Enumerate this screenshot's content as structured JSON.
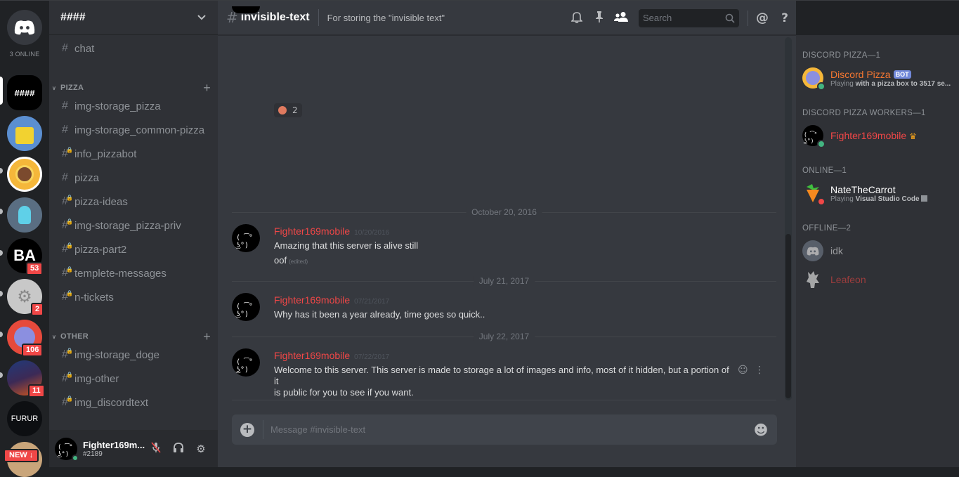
{
  "guilds": {
    "online_count": "3 ONLINE",
    "selected_guild_label": "####",
    "badges": [
      "53",
      "2",
      "106",
      "11"
    ],
    "furur_label": "FURUR",
    "new_label": "NEW ↓"
  },
  "sidebar": {
    "guild_name": "####",
    "top_channel": "chat",
    "categories": [
      {
        "name": "PIZZA",
        "channels": [
          {
            "name": "img-storage_pizza",
            "locked": false
          },
          {
            "name": "img-storage_common-pizza",
            "locked": false
          },
          {
            "name": "info_pizzabot",
            "locked": true
          },
          {
            "name": "pizza",
            "locked": false
          },
          {
            "name": "pizza-ideas",
            "locked": true
          },
          {
            "name": "img-storage_pizza-priv",
            "locked": true
          },
          {
            "name": "pizza-part2",
            "locked": true
          },
          {
            "name": "templete-messages",
            "locked": true
          },
          {
            "name": "n-tickets",
            "locked": true
          }
        ]
      },
      {
        "name": "OTHER",
        "channels": [
          {
            "name": "img-storage_doge",
            "locked": true
          },
          {
            "name": "img-other",
            "locked": true
          },
          {
            "name": "img_discordtext",
            "locked": true
          }
        ]
      }
    ],
    "user": {
      "name": "Fighter169m...",
      "tag": "#2189"
    }
  },
  "chat": {
    "channel_name": "invisible-text",
    "topic": "For storing the \"invisible text\"",
    "search_placeholder": "Search",
    "reaction_count": "2",
    "dividers": [
      "October 20, 2016",
      "July 21, 2017",
      "July 22, 2017"
    ],
    "messages": [
      {
        "author": "Fighter169mobile",
        "time": "10/20/2016",
        "lines": [
          "Amazing that this server is alive still",
          "oof"
        ],
        "edited": "(edited)"
      },
      {
        "author": "Fighter169mobile",
        "time": "07/21/2017",
        "lines": [
          "Why has it been a year already, time goes so quick.."
        ]
      },
      {
        "author": "Fighter169mobile",
        "time": "07/22/2017",
        "lines": [
          "Welcome to this server. This server is made to storage a lot of images and info, most of it hidden, but a portion of it",
          "is public for you to see if you want."
        ]
      }
    ],
    "composer_placeholder": "Message #invisible-text"
  },
  "members": {
    "groups": [
      {
        "label": "DISCORD PIZZA—1",
        "members": [
          {
            "name": "Discord Pizza",
            "bot_tag": "BOT",
            "activity_prefix": "Playing ",
            "activity": "with a pizza box to 3517 se...",
            "color": "#f57731"
          }
        ]
      },
      {
        "label": "DISCORD PIZZA WORKERS—1",
        "members": [
          {
            "name": "Fighter169mobile",
            "crown": "♛",
            "color": "#f04747"
          }
        ]
      },
      {
        "label": "ONLINE—1",
        "members": [
          {
            "name": "NateTheCarrot",
            "activity_prefix": "Playing ",
            "activity": "Visual Studio Code",
            "color": "#ffffff"
          }
        ]
      },
      {
        "label": "OFFLINE—2",
        "members": [
          {
            "name": "idk",
            "color": "#b9bbbe"
          },
          {
            "name": "Leafeon",
            "color": "#a04040"
          }
        ]
      }
    ]
  },
  "colors": {
    "online": "#43b581",
    "dnd": "#f04747",
    "blurple": "#7289da",
    "author_red": "#f04747"
  }
}
